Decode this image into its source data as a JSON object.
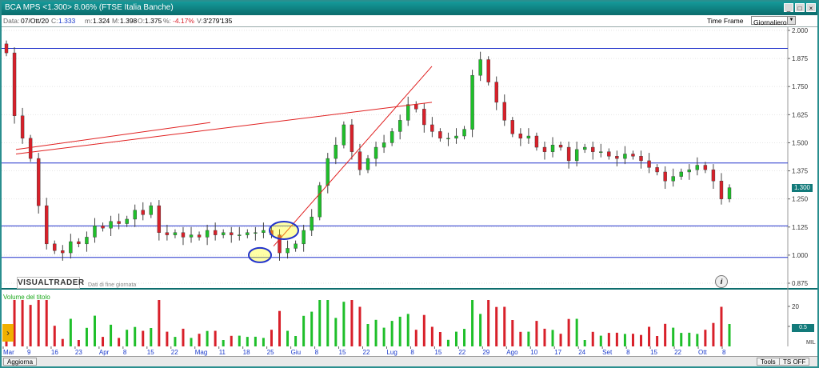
{
  "window": {
    "title": "BCA MPS <1.300> 8.06%  (FTSE Italia Banche)",
    "buttons": [
      "_",
      "□",
      "×"
    ]
  },
  "infobar": {
    "data_label": "Data:",
    "data_value": "07/Ott/20",
    "c_label": "C:",
    "c_value": "1.333",
    "m_label": "m:",
    "m_value": "1.324",
    "M_label": "M:",
    "M_value": "1.398",
    "o_label": "O:",
    "o_value": "1.375",
    "pct_label": "%:",
    "pct_value": "-4.17%",
    "v_label": "V:",
    "v_value": "3'279'135",
    "timeframe_label": "Time Frame",
    "timeframe_value": "Giornaliero"
  },
  "logo": {
    "text": "VISUALTRADER",
    "sub": "Dati di fine giornata"
  },
  "volume_title": "Volume del titolo",
  "price_tag": "1.300",
  "vol_tag": "0.5",
  "mil_label": "MIL",
  "bottom": {
    "aggiorna": "Aggiorna",
    "tools": "Tools",
    "ts_off": "TS OFF"
  },
  "colors": {
    "up": "#1fbf2a",
    "down": "#d8202a",
    "hline": "#2233cc",
    "trend": "#e02020"
  },
  "chart_data": {
    "type": "candlestick",
    "ylim": [
      0.875,
      2.0
    ],
    "y_ticks": [
      "2.000",
      "1.875",
      "1.750",
      "1.625",
      "1.500",
      "1.375",
      "1.250",
      "1.125",
      "1.000",
      "0.875"
    ],
    "x_ticks": [
      "Mar",
      "9",
      "16",
      "23",
      "Apr",
      "8",
      "15",
      "22",
      "Mag",
      "11",
      "18",
      "25",
      "Giu",
      "8",
      "15",
      "22",
      "Lug",
      "8",
      "15",
      "22",
      "29",
      "Ago",
      "10",
      "17",
      "24",
      "Set",
      "8",
      "15",
      "22",
      "Ott",
      "8"
    ],
    "vol_ticks": [
      "20",
      "10"
    ],
    "horizontal_levels": [
      1.92,
      1.41,
      1.13,
      0.99
    ],
    "close_values": [
      1.9,
      1.62,
      1.52,
      1.43,
      1.22,
      1.05,
      1.02,
      1.01,
      1.06,
      1.05,
      1.08,
      1.13,
      1.12,
      1.15,
      1.14,
      1.16,
      1.2,
      1.18,
      1.22,
      1.1,
      1.09,
      1.1,
      1.08,
      1.09,
      1.08,
      1.11,
      1.09,
      1.1,
      1.09,
      1.09,
      1.1,
      1.1,
      1.11,
      1.09,
      1.01,
      1.03,
      1.05,
      1.11,
      1.17,
      1.31,
      1.43,
      1.49,
      1.58,
      1.46,
      1.38,
      1.43,
      1.48,
      1.5,
      1.55,
      1.6,
      1.67,
      1.65,
      1.58,
      1.55,
      1.52,
      1.52,
      1.53,
      1.56,
      1.8,
      1.87,
      1.77,
      1.68,
      1.6,
      1.54,
      1.52,
      1.53,
      1.48,
      1.46,
      1.49,
      1.48,
      1.42,
      1.47,
      1.48,
      1.46,
      1.46,
      1.44,
      1.43,
      1.45,
      1.44,
      1.42,
      1.39,
      1.37,
      1.33,
      1.35,
      1.37,
      1.38,
      1.4,
      1.38,
      1.33,
      1.25,
      1.3
    ]
  }
}
